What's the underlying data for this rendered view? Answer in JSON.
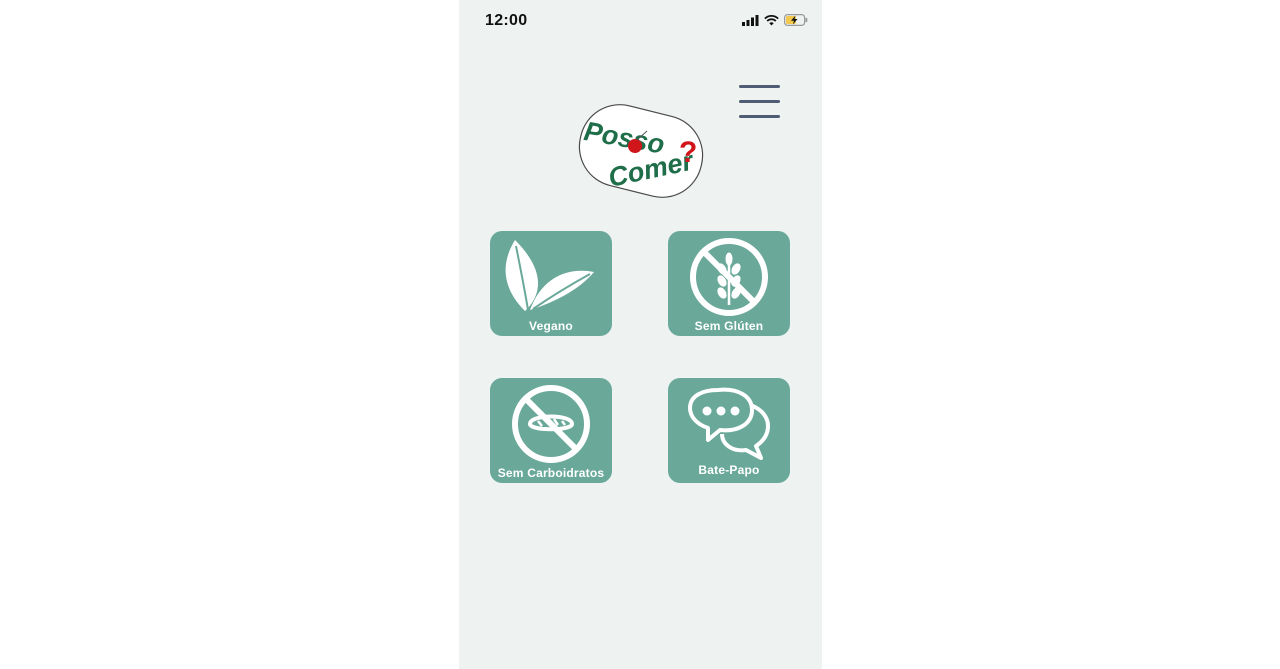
{
  "status_bar": {
    "time": "12:00"
  },
  "logo": {
    "line1": "Posso",
    "line2": "Comer",
    "mark": "?"
  },
  "menu": {
    "icon": "hamburger-menu-icon"
  },
  "cards": [
    {
      "label": "Vegano",
      "icon": "leaves-icon"
    },
    {
      "label": "Sem Glúten",
      "icon": "no-gluten-icon"
    },
    {
      "label": "Sem Carboidratos",
      "icon": "no-bread-icon"
    },
    {
      "label": "Bate-Papo",
      "icon": "chat-bubbles-icon"
    }
  ],
  "colors": {
    "card": "#6aa99a",
    "background": "#eef2f1",
    "menu": "#4e5d73",
    "logo_green": "#1f6e4a",
    "logo_red": "#d0151b"
  }
}
